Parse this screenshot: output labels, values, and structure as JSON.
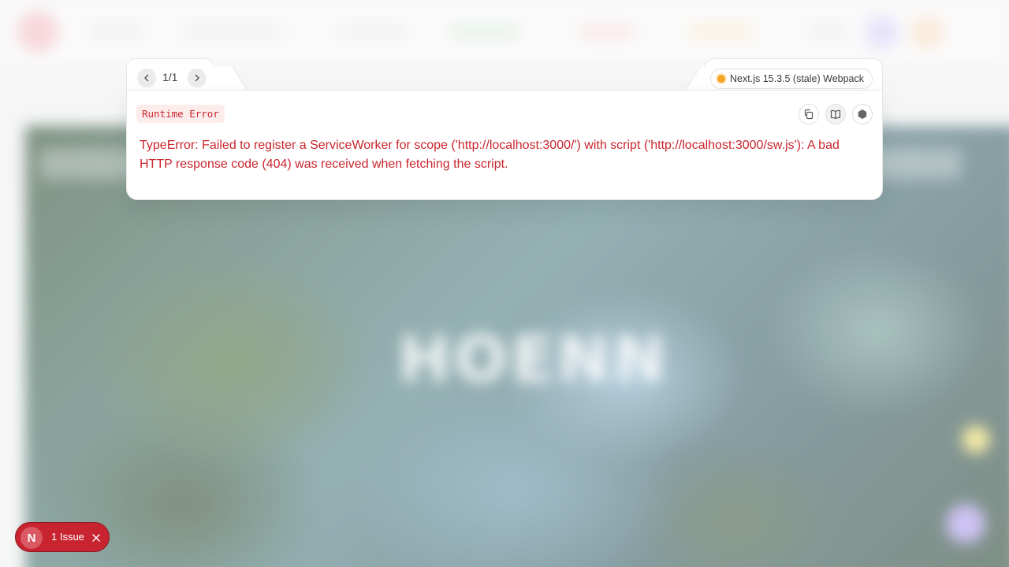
{
  "background": {
    "hero_title": "HOENN",
    "colors": {
      "logo": "#f7c6cd",
      "nav_pills": [
        "#f0f0f0",
        "#f0f0f0",
        "#f0f0f0",
        "#e3f1e3",
        "#fbe3e3",
        "#fbf0d6",
        "#f0f0f0"
      ],
      "avatars": [
        "#dcd8fb",
        "#fbe5cc"
      ]
    }
  },
  "overlay": {
    "pager": {
      "text": "1/1",
      "prev_icon": "chevron-left-icon",
      "next_icon": "chevron-right-icon"
    },
    "version": {
      "text": "Next.js 15.3.5 (stale) Webpack",
      "status_color": "#f5a623"
    },
    "error_type": "Runtime Error",
    "error_message": "TypeError: Failed to register a ServiceWorker for scope ('http://localhost:3000/') with script ('http://localhost:3000/sw.js'): A bad HTTP response code (404) was received when fetching the script.",
    "tools": [
      "copy-icon",
      "docs-icon",
      "nodejs-icon"
    ],
    "accent_color": "#c9252d"
  },
  "issues": {
    "logo_letter": "N",
    "label": "1 Issue",
    "close_icon": "close-icon",
    "color": "#c82430"
  }
}
